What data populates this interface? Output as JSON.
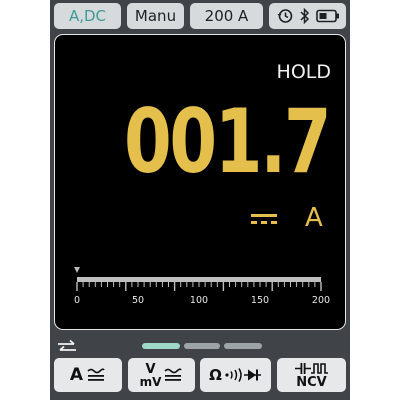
{
  "status_bar": {
    "mode": "A,DC",
    "range_mode": "Manu",
    "range_value": "200 A",
    "icons": [
      "history-icon",
      "bluetooth-icon",
      "battery-icon"
    ]
  },
  "display": {
    "hold_label": "HOLD",
    "reading": "001.7",
    "current_type_icon": "dc-icon",
    "unit": "A"
  },
  "bargraph": {
    "tick_labels": [
      "0",
      "50",
      "100",
      "150",
      "200"
    ],
    "min": 0,
    "max": 200,
    "pointer_value": 0
  },
  "pager": {
    "swap_icon": "swap-icon",
    "active_page": 1,
    "page_count": 3
  },
  "function_buttons": {
    "amps": {
      "label": "A",
      "icon": "ac-dc-icon"
    },
    "volts": {
      "label_top": "V",
      "label_bottom": "mV",
      "icon": "ac-dc-icon"
    },
    "ohm": {
      "label": "Ω",
      "icons": [
        "continuity-icon",
        "diode-icon"
      ]
    },
    "ncv": {
      "label": "NCV",
      "icons": [
        "capacitor-icon",
        "frequency-icon"
      ]
    }
  },
  "colors": {
    "reading": "#e4bf4c",
    "mode_text": "#3f9a95",
    "active_page_dot": "#9fd9c8",
    "inactive_page_dot": "#9ea3a8",
    "device_body": "#404448"
  }
}
